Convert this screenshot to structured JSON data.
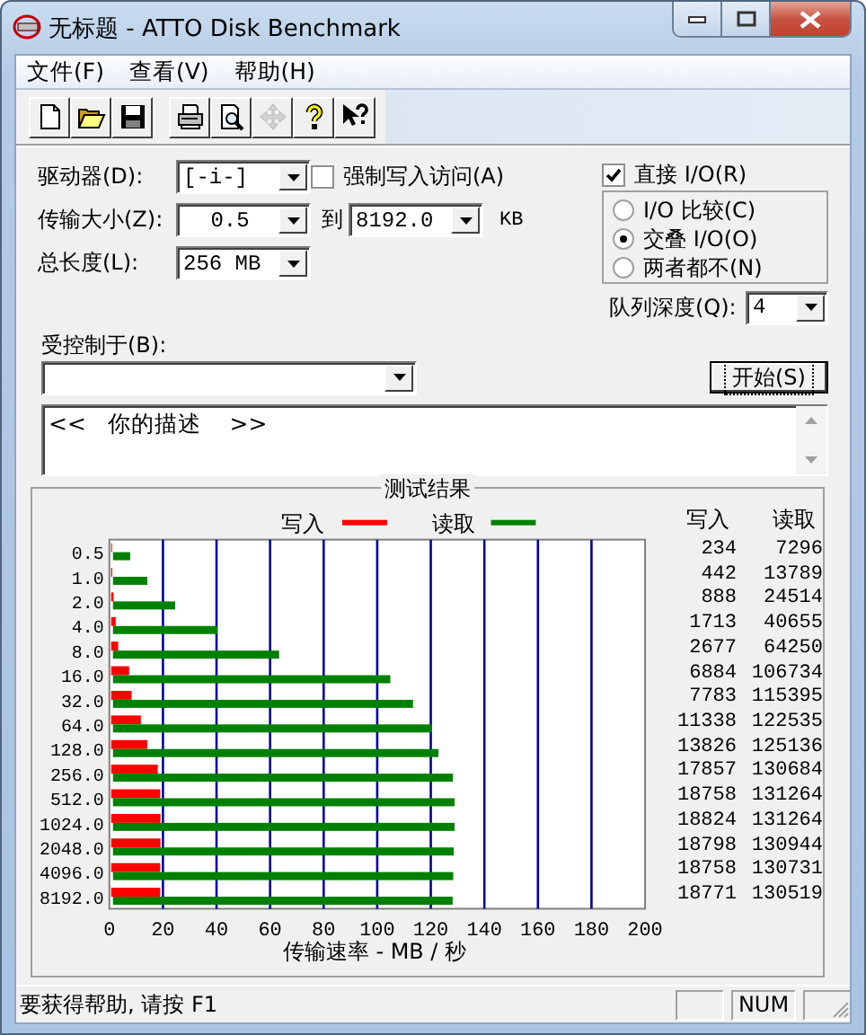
{
  "window": {
    "title": "无标题 - ATTO Disk Benchmark"
  },
  "menu": [
    {
      "label": "文件(F)"
    },
    {
      "label": "查看(V)"
    },
    {
      "label": "帮助(H)"
    }
  ],
  "toolbar": [
    {
      "kind": "new",
      "disabled": false
    },
    {
      "kind": "open",
      "disabled": false
    },
    {
      "kind": "save",
      "disabled": false
    },
    {
      "kind": "print",
      "disabled": false
    },
    {
      "kind": "preview",
      "disabled": false
    },
    {
      "kind": "move",
      "disabled": true
    },
    {
      "kind": "help",
      "disabled": false
    },
    {
      "kind": "context_help",
      "disabled": false
    }
  ],
  "form": {
    "drive": {
      "label": "驱动器(D):",
      "value": "[-i-]"
    },
    "force_write": {
      "label": "强制写入访问(A)",
      "checked": false
    },
    "transfer_size": {
      "label": "传输大小(Z):",
      "from": "0.5",
      "to_label": "到",
      "to": "8192.0",
      "unit": "KB"
    },
    "total_length": {
      "label": "总长度(L):",
      "value": "256 MB"
    },
    "direct_io": {
      "label": "直接 I/O(R)",
      "checked": true
    },
    "io_modes": [
      {
        "label": "I/O 比较(C)",
        "selected": false
      },
      {
        "label": "交叠 I/O(O)",
        "selected": true
      },
      {
        "label": "两者都不(N)",
        "selected": false
      }
    ],
    "queue_depth": {
      "label": "队列深度(Q):",
      "value": "4"
    },
    "controlled_by": {
      "label": "受控制于(B):"
    },
    "start_button": "开始(S)",
    "description": "<<   你的描述    >>"
  },
  "results": {
    "title": "测试结果",
    "columns": [
      "写入",
      "读取"
    ],
    "rows": [
      {
        "write": "234",
        "read": "7296"
      },
      {
        "write": "442",
        "read": "13789"
      },
      {
        "write": "888",
        "read": "24514"
      },
      {
        "write": "1713",
        "read": "40655"
      },
      {
        "write": "2677",
        "read": "64250"
      },
      {
        "write": "6884",
        "read": "106734"
      },
      {
        "write": "7783",
        "read": "115395"
      },
      {
        "write": "11338",
        "read": "122535"
      },
      {
        "write": "13826",
        "read": "125136"
      },
      {
        "write": "17857",
        "read": "130684"
      },
      {
        "write": "18758",
        "read": "131264"
      },
      {
        "write": "18824",
        "read": "131264"
      },
      {
        "write": "18798",
        "read": "130944"
      },
      {
        "write": "18758",
        "read": "130731"
      },
      {
        "write": "18771",
        "read": "130519"
      }
    ],
    "chart_data": {
      "type": "bar",
      "orientation": "horizontal",
      "xlabel": "传输速率 - MB / 秒",
      "categories": [
        "0.5",
        "1.0",
        "2.0",
        "4.0",
        "8.0",
        "16.0",
        "32.0",
        "64.0",
        "128.0",
        "256.0",
        "512.0",
        "1024.0",
        "2048.0",
        "4096.0",
        "8192.0"
      ],
      "series": [
        {
          "name": "写入",
          "color": "#ff0000",
          "values": [
            0.2,
            0.4,
            0.9,
            1.7,
            2.6,
            6.7,
            7.6,
            11.1,
            13.5,
            17.4,
            18.3,
            18.4,
            18.4,
            18.3,
            18.3
          ]
        },
        {
          "name": "读取",
          "color": "#008000",
          "values": [
            7.1,
            13.5,
            23.9,
            39.7,
            62.7,
            104.2,
            112.7,
            119.7,
            122.2,
            127.6,
            128.2,
            128.2,
            127.9,
            127.7,
            127.5
          ]
        }
      ],
      "xlim": [
        0,
        200
      ],
      "xticks": [
        0,
        20,
        40,
        60,
        80,
        100,
        120,
        140,
        160,
        180,
        200
      ],
      "grid": true,
      "legend": true
    }
  },
  "status_bar": {
    "text": "要获得帮助, 请按 F1",
    "num_indicator": "NUM"
  }
}
